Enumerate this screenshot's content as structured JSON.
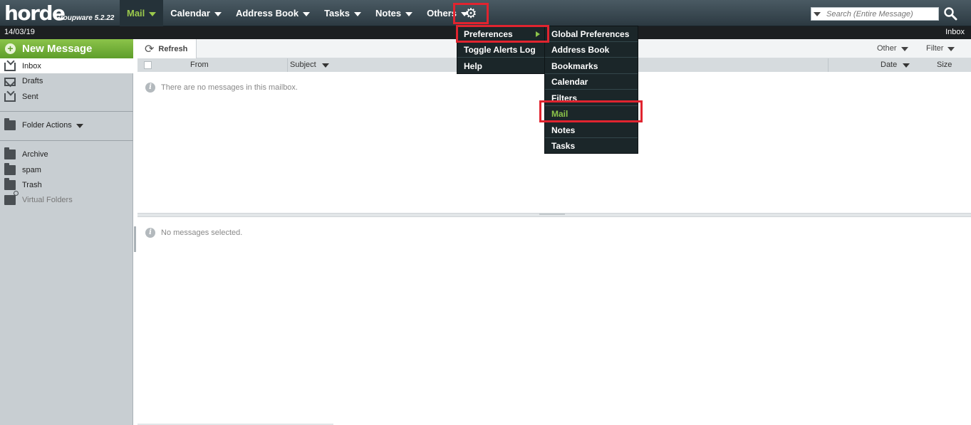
{
  "header": {
    "logo_text": "horde",
    "logo_subtitle": "Groupware 5.2.22",
    "nav": [
      {
        "label": "Mail"
      },
      {
        "label": "Calendar"
      },
      {
        "label": "Address Book"
      },
      {
        "label": "Tasks"
      },
      {
        "label": "Notes"
      },
      {
        "label": "Others"
      }
    ],
    "settings_icon": "gear-icon",
    "search_placeholder": "Search (Entire Message)",
    "search_icon": "search-icon"
  },
  "datebar": {
    "date": "14/03/19",
    "current_folder": "Inbox"
  },
  "sidebar": {
    "new_message": "New Message",
    "folders": [
      {
        "label": "Inbox",
        "icon": "inbox-icon"
      },
      {
        "label": "Drafts",
        "icon": "envelope-open-icon"
      },
      {
        "label": "Sent",
        "icon": "sent-icon"
      }
    ],
    "folder_actions": "Folder Actions",
    "extra_folders": [
      {
        "label": "Archive",
        "icon": "folder-icon"
      },
      {
        "label": "spam",
        "icon": "folder-icon"
      },
      {
        "label": "Trash",
        "icon": "folder-icon"
      },
      {
        "label": "Virtual Folders",
        "icon": "virtual-folder-icon"
      }
    ]
  },
  "toolbar": {
    "refresh": "Refresh",
    "other": "Other",
    "filter": "Filter"
  },
  "columns": {
    "from": "From",
    "subject": "Subject",
    "date": "Date",
    "size": "Size"
  },
  "messages": {
    "empty": "There are no messages in this mailbox.",
    "none_selected": "No messages selected."
  },
  "settings_menu": {
    "items": [
      {
        "label": "Preferences"
      },
      {
        "label": "Toggle Alerts Log"
      },
      {
        "label": "Help"
      }
    ]
  },
  "preferences_submenu": {
    "items": [
      {
        "label": "Global Preferences"
      },
      {
        "label": "Address Book"
      },
      {
        "label": "Bookmarks"
      },
      {
        "label": "Calendar"
      },
      {
        "label": "Filters"
      },
      {
        "label": "Mail"
      },
      {
        "label": "Notes"
      },
      {
        "label": "Tasks"
      }
    ]
  },
  "colors": {
    "accent_green": "#8bc34a",
    "highlight_red": "#e0242f",
    "menu_bg": "#1b2629"
  }
}
